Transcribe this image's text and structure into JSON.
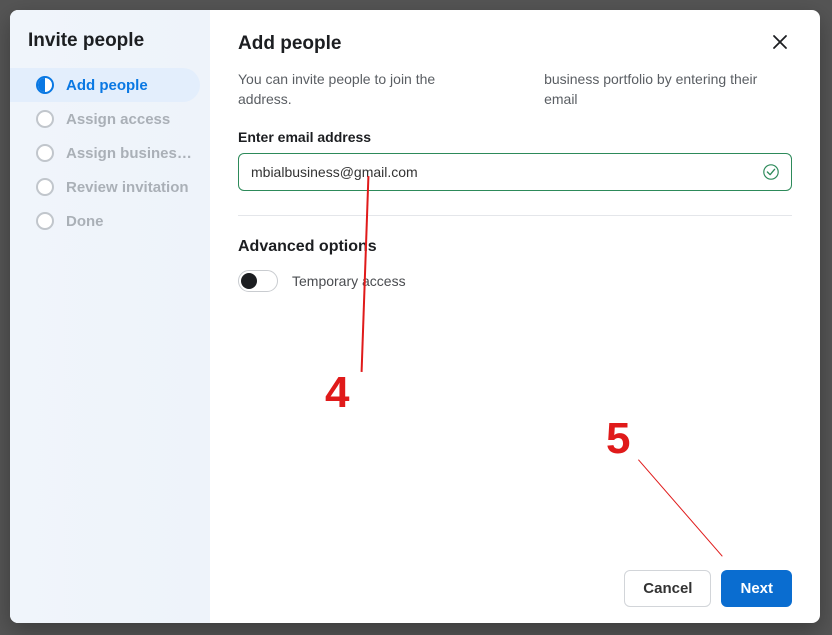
{
  "sidebar": {
    "title": "Invite people",
    "steps": [
      {
        "label": "Add people",
        "active": true
      },
      {
        "label": "Assign access",
        "active": false
      },
      {
        "label": "Assign business a...",
        "active": false
      },
      {
        "label": "Review invitation",
        "active": false
      },
      {
        "label": "Done",
        "active": false
      }
    ]
  },
  "main": {
    "title": "Add people",
    "subtext_left": "You can invite people to join the address.",
    "subtext_right": "business portfolio by entering their email",
    "email_label": "Enter email address",
    "email_value": "mbialbusiness@gmail.com",
    "advanced_title": "Advanced options",
    "toggle_label": "Temporary access"
  },
  "footer": {
    "cancel": "Cancel",
    "next": "Next"
  },
  "annotations": {
    "four": "4",
    "five": "5"
  }
}
